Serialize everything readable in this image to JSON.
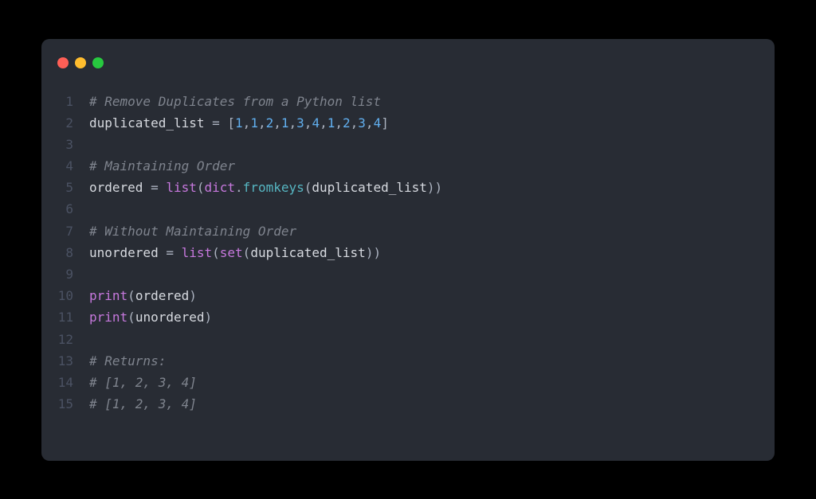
{
  "titlebar": {
    "buttons": [
      "close",
      "minimize",
      "maximize"
    ]
  },
  "code": {
    "lines": [
      {
        "n": "1",
        "tokens": [
          {
            "c": "tk-comment",
            "t": "# Remove Duplicates from a Python list"
          }
        ]
      },
      {
        "n": "2",
        "tokens": [
          {
            "c": "tk-plain",
            "t": "duplicated_list "
          },
          {
            "c": "tk-op",
            "t": "= "
          },
          {
            "c": "tk-punct",
            "t": "["
          },
          {
            "c": "tk-num",
            "t": "1"
          },
          {
            "c": "tk-punct",
            "t": ","
          },
          {
            "c": "tk-num",
            "t": "1"
          },
          {
            "c": "tk-punct",
            "t": ","
          },
          {
            "c": "tk-num",
            "t": "2"
          },
          {
            "c": "tk-punct",
            "t": ","
          },
          {
            "c": "tk-num",
            "t": "1"
          },
          {
            "c": "tk-punct",
            "t": ","
          },
          {
            "c": "tk-num",
            "t": "3"
          },
          {
            "c": "tk-punct",
            "t": ","
          },
          {
            "c": "tk-num",
            "t": "4"
          },
          {
            "c": "tk-punct",
            "t": ","
          },
          {
            "c": "tk-num",
            "t": "1"
          },
          {
            "c": "tk-punct",
            "t": ","
          },
          {
            "c": "tk-num",
            "t": "2"
          },
          {
            "c": "tk-punct",
            "t": ","
          },
          {
            "c": "tk-num",
            "t": "3"
          },
          {
            "c": "tk-punct",
            "t": ","
          },
          {
            "c": "tk-num",
            "t": "4"
          },
          {
            "c": "tk-punct",
            "t": "]"
          }
        ]
      },
      {
        "n": "3",
        "tokens": []
      },
      {
        "n": "4",
        "tokens": [
          {
            "c": "tk-comment",
            "t": "# Maintaining Order"
          }
        ]
      },
      {
        "n": "5",
        "tokens": [
          {
            "c": "tk-plain",
            "t": "ordered "
          },
          {
            "c": "tk-op",
            "t": "= "
          },
          {
            "c": "tk-builtin",
            "t": "list"
          },
          {
            "c": "tk-punct",
            "t": "("
          },
          {
            "c": "tk-builtin",
            "t": "dict"
          },
          {
            "c": "tk-punct",
            "t": "."
          },
          {
            "c": "tk-func",
            "t": "fromkeys"
          },
          {
            "c": "tk-punct",
            "t": "("
          },
          {
            "c": "tk-plain",
            "t": "duplicated_list"
          },
          {
            "c": "tk-punct",
            "t": "))"
          }
        ]
      },
      {
        "n": "6",
        "tokens": []
      },
      {
        "n": "7",
        "tokens": [
          {
            "c": "tk-comment",
            "t": "# Without Maintaining Order"
          }
        ]
      },
      {
        "n": "8",
        "tokens": [
          {
            "c": "tk-plain",
            "t": "unordered "
          },
          {
            "c": "tk-op",
            "t": "= "
          },
          {
            "c": "tk-builtin",
            "t": "list"
          },
          {
            "c": "tk-punct",
            "t": "("
          },
          {
            "c": "tk-builtin",
            "t": "set"
          },
          {
            "c": "tk-punct",
            "t": "("
          },
          {
            "c": "tk-plain",
            "t": "duplicated_list"
          },
          {
            "c": "tk-punct",
            "t": "))"
          }
        ]
      },
      {
        "n": "9",
        "tokens": []
      },
      {
        "n": "10",
        "tokens": [
          {
            "c": "tk-builtin",
            "t": "print"
          },
          {
            "c": "tk-punct",
            "t": "("
          },
          {
            "c": "tk-plain",
            "t": "ordered"
          },
          {
            "c": "tk-punct",
            "t": ")"
          }
        ]
      },
      {
        "n": "11",
        "tokens": [
          {
            "c": "tk-builtin",
            "t": "print"
          },
          {
            "c": "tk-punct",
            "t": "("
          },
          {
            "c": "tk-plain",
            "t": "unordered"
          },
          {
            "c": "tk-punct",
            "t": ")"
          }
        ]
      },
      {
        "n": "12",
        "tokens": []
      },
      {
        "n": "13",
        "tokens": [
          {
            "c": "tk-comment",
            "t": "# Returns:"
          }
        ]
      },
      {
        "n": "14",
        "tokens": [
          {
            "c": "tk-comment",
            "t": "# [1, 2, 3, 4]"
          }
        ]
      },
      {
        "n": "15",
        "tokens": [
          {
            "c": "tk-comment",
            "t": "# [1, 2, 3, 4]"
          }
        ]
      }
    ]
  }
}
